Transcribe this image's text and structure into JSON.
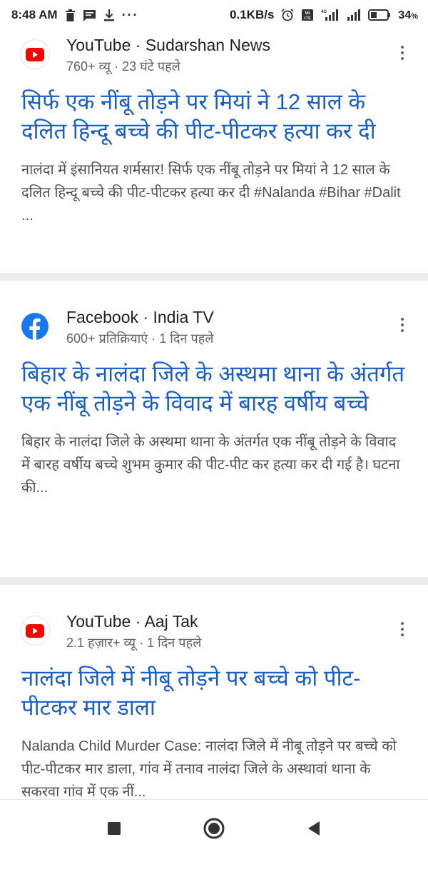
{
  "status_bar": {
    "time": "8:48 AM",
    "notification_icons": [
      "trash-icon",
      "message-icon",
      "download-icon"
    ],
    "more_notifications": "···",
    "network_speed": "0.1KB/s",
    "system_icons": [
      "alarm-icon",
      "volte-icon",
      "signal-4g-icon",
      "signal-icon"
    ],
    "battery_percent": "34",
    "battery_percent_sign": "%"
  },
  "results": [
    {
      "source_icon": "youtube-icon",
      "source": "YouTube · Sudarshan News",
      "meta": "760+ व्यू · 23 घंटे पहले",
      "title": "सिर्फ एक नींबू तोड़ने पर मियां ने 12 साल के दलित हिन्दू बच्चे की पीट-पीटकर हत्या कर दी",
      "snippet": "नालंदा में इंसानियत शर्मसार! सिर्फ एक नींबू तोड़ने पर मियां ने 12 साल के दलित हिन्दू बच्चे की पीट-पीटकर हत्या कर दी #Nalanda #Bihar #Dalit ..."
    },
    {
      "source_icon": "facebook-icon",
      "source": "Facebook · India TV",
      "meta": "600+ प्रतिक्रियाएं · 1 दिन पहले",
      "title": "बिहार के नालंदा जिले के अस्थमा थाना के अंतर्गत एक नींबू तोड़ने के विवाद में बारह वर्षीय बच्चे",
      "snippet": "बिहार के नालंदा जिले के अस्थमा थाना के अंतर्गत एक नींबू तोड़ने के विवाद में बारह वर्षीय बच्चे शुभम कुमार की पीट-पीट कर हत्या कर दी गई है। घटना की..."
    },
    {
      "source_icon": "youtube-icon",
      "source": "YouTube · Aaj Tak",
      "meta": "2.1 हज़ार+ व्यू · 1 दिन पहले",
      "title": "नालंदा जिले में नीबू तोड़ने पर बच्चे को पीट-पीटकर मार डाला",
      "snippet": "Nalanda Child Murder Case: नालंदा जिले में नीबू तोड़ने पर बच्चे को पीट-पीटकर मार डाला, गांव में तनाव नालंदा जिले के अस्थावां थाना के सकरवा गांव में एक नीं..."
    }
  ],
  "nav_bar": {
    "buttons": [
      "recents-square-icon",
      "home-circle-icon",
      "back-triangle-icon"
    ]
  },
  "colors": {
    "title_link": "#1a5dc4",
    "youtube_red": "#ff0000",
    "facebook_blue": "#1877f2",
    "divider": "#ececec"
  }
}
